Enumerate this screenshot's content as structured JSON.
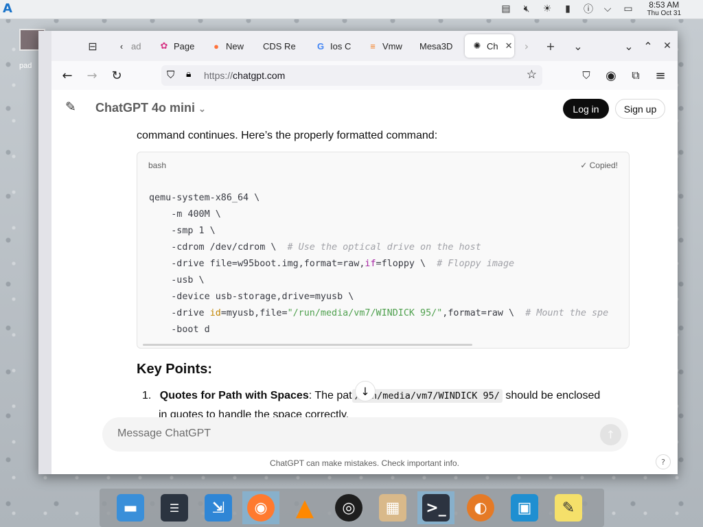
{
  "panel": {
    "logo": "A",
    "tray_icons": [
      "clipboard-icon",
      "speaker-muted-icon",
      "brightness-icon",
      "usb-drive-icon",
      "help-circle-icon",
      "chevron-down-icon",
      "window-icon"
    ],
    "time": "8:53 AM",
    "date": "Thu Oct 31"
  },
  "desktop": {
    "icon_label": "pad"
  },
  "browser": {
    "tabs": [
      {
        "label": "ad",
        "icon": "chevron-left-icon"
      },
      {
        "label": "Page",
        "icon": "pagerduty-icon"
      },
      {
        "label": "New",
        "icon": "firefox-icon"
      },
      {
        "label": "CDS Re",
        "icon": "none"
      },
      {
        "label": "Ios C",
        "icon": "google-icon"
      },
      {
        "label": "Vmw",
        "icon": "stackoverflow-icon"
      },
      {
        "label": "Mesa3D",
        "icon": "none"
      },
      {
        "label": "Ch",
        "icon": "chatgpt-icon",
        "active": true
      }
    ],
    "url_protocol": "https://",
    "url_host": "chatgpt.com"
  },
  "chat": {
    "model_title": "ChatGPT 4o mini",
    "login_label": "Log in",
    "signup_label": "Sign up",
    "intro_text": "command continues. Here’s the properly formatted command:",
    "code_lang": "bash",
    "copied_label": "Copied!",
    "code_lines": {
      "l1": "qemu-system-x86_64 \\",
      "l2": "    -m 400M \\",
      "l3": "    -smp 1 \\",
      "l4a": "    -cdrom /dev/cdrom \\  ",
      "l4c": "# Use the optical drive on the host",
      "l5a": "    -drive file=w95boot.img,format=raw,",
      "l5k": "if",
      "l5b": "=floppy \\  ",
      "l5c": "# Floppy image",
      "l6": "    -usb \\",
      "l7": "    -device usb-storage,drive=myusb \\",
      "l8a": "    -drive ",
      "l8k": "id",
      "l8b": "=myusb,file=",
      "l8s": "\"/run/media/vm7/WINDICK 95/\"",
      "l8d": ",format=raw \\  ",
      "l8c": "# Mount the spe",
      "l9": "    -boot d"
    },
    "heading": "Key Points:",
    "point1_num": "1.",
    "point1_bold": "Quotes for Path with Spaces",
    "point1_text_a": ": The pat",
    "point1_code": "/run/media/vm7/WINDICK 95/",
    "point1_text_b": " should be enclosed",
    "point1_cont": "in quotes to handle the space correctly.",
    "composer_placeholder": "Message ChatGPT",
    "disclaimer": "ChatGPT can make mistakes. Check important info.",
    "help": "?"
  },
  "dock": {
    "apps": [
      "file-manager",
      "settings",
      "app-store",
      "firefox",
      "vlc",
      "obs",
      "archive",
      "terminal",
      "pidgin",
      "virtualbox",
      "text-editor"
    ]
  }
}
